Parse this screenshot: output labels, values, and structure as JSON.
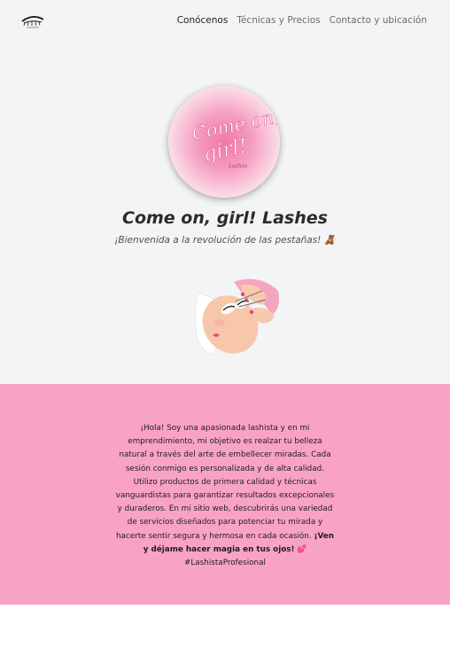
{
  "nav": {
    "items": [
      {
        "label": "Conócenos",
        "active": true
      },
      {
        "label": "Técnicas y Precios",
        "active": false
      },
      {
        "label": "Contacto y ubicación",
        "active": false
      }
    ]
  },
  "hero": {
    "badge_text_line1": "Come on,",
    "badge_text_line2": "girl!",
    "badge_text_small": "Lashes",
    "title": "Come on, girl! Lashes",
    "subtitle": "¡Bienvenida a la revolución de las pestañas! 🧸"
  },
  "about": {
    "paragraph": "¡Hola! Soy una apasionada lashista y en mi emprendimiento, mi objetivo es realzar tu belleza natural a través del arte de embellecer miradas. Cada sesión conmigo es personalizada y de alta calidad. Utilizo productos de primera calidad y técnicas vanguardistas para garantizar resultados excepcionales y duraderos. En mi sitio web, descubrirás una variedad de servicios diseñados para potenciar tu mirada y hacerte sentir segura y hermosa en cada ocasión.",
    "cta_bold": "¡Ven y déjame hacer magia en tus ojos!",
    "heart": "💕",
    "hashtag": "#LashistaProfesional"
  },
  "colors": {
    "hero_bg": "#f3f4f6",
    "about_bg": "#f9a3c4",
    "accent_pink": "#f07aa7"
  }
}
